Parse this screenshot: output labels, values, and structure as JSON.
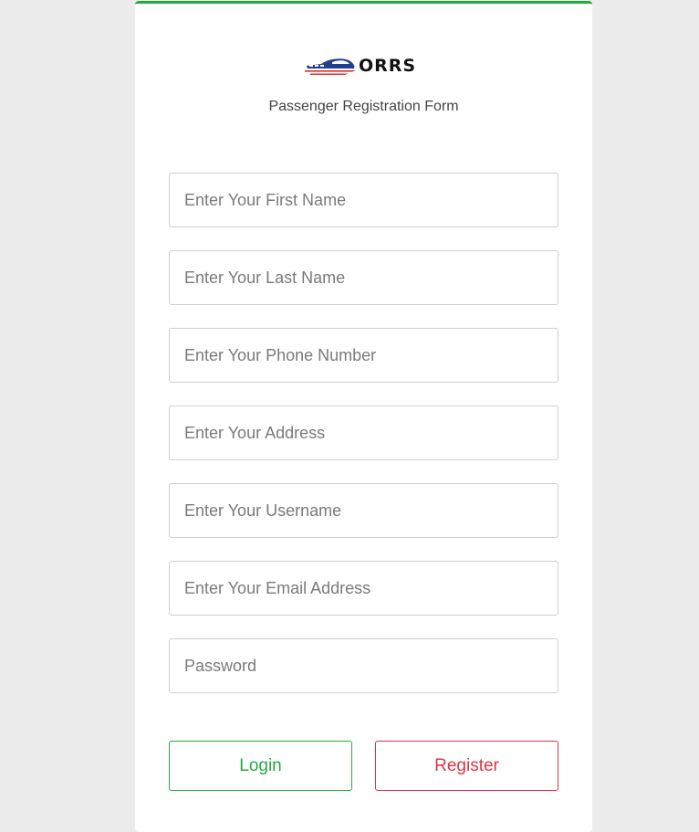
{
  "brand": {
    "logo_text": "ORRS",
    "icon": "train-icon",
    "colors": {
      "primary": "#1f3f8f",
      "accent": "#e03030"
    }
  },
  "form": {
    "subtitle": "Passenger Registration Form",
    "fields": {
      "first_name": "Enter Your First Name",
      "last_name": "Enter Your Last Name",
      "phone": "Enter Your Phone Number",
      "address": "Enter Your Address",
      "username": "Enter Your Username",
      "email": "Enter Your Email Address",
      "password": "Password"
    },
    "buttons": {
      "login": "Login",
      "register": "Register"
    }
  },
  "theme": {
    "success": "#28a745",
    "danger": "#dc3545",
    "background": "#ececec"
  }
}
